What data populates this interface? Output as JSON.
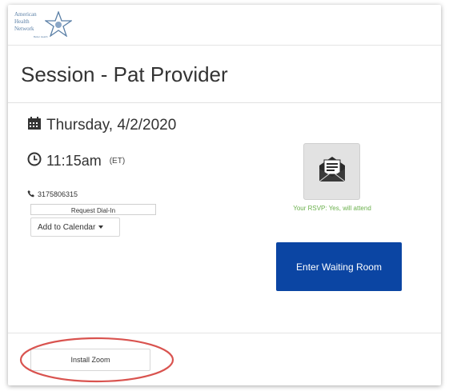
{
  "logo": {
    "lines": [
      "American",
      "Health",
      "Network"
    ],
    "tagline": "Better Health",
    "icon": "star-icon"
  },
  "session": {
    "title": "Session - Pat Provider",
    "date": "Thursday, 4/2/2020",
    "time": "11:15am",
    "timezone": "(ET)",
    "phone": "3175806315"
  },
  "actions": {
    "request_dialin": "Request Dial-In",
    "add_to_calendar": "Add to Calendar",
    "enter_waiting_room": "Enter Waiting Room",
    "install_zoom": "Install Zoom"
  },
  "rsvp": {
    "text": "Your RSVP: Yes, will attend",
    "icon": "envelope-icon"
  },
  "colors": {
    "primary_button": "#0b45a3",
    "rsvp_text": "#6ab04c",
    "annotation": "#d9534f",
    "logo": "#5a7fa6"
  },
  "icons": {
    "date": "calendar-icon",
    "time": "clock-icon",
    "phone": "phone-icon",
    "dropdown": "caret-down-icon"
  }
}
